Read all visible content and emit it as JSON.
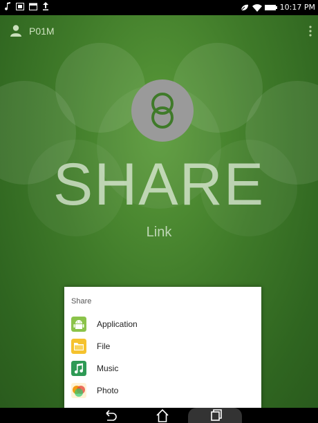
{
  "status_bar": {
    "time": "10:17 PM",
    "left_icons": [
      "music-note-icon",
      "screenshot-icon",
      "calendar-icon",
      "upload-icon"
    ],
    "right_icons": [
      "power-saver-icon",
      "wifi-icon",
      "battery-icon"
    ]
  },
  "header": {
    "device_name": "P01M",
    "avatar_icon": "person-icon",
    "menu_icon": "overflow-menu-icon"
  },
  "main": {
    "logo_icon": "link-rings-icon",
    "title": "SHARE",
    "subtitle": "Link"
  },
  "share_dialog": {
    "title": "Share",
    "items": [
      {
        "label": "Application",
        "icon": "android-icon",
        "color": "#8bc34a"
      },
      {
        "label": "File",
        "icon": "folder-icon",
        "color": "#f5c22e"
      },
      {
        "label": "Music",
        "icon": "music-icon",
        "color": "#2e9a55"
      },
      {
        "label": "Photo",
        "icon": "photo-icon",
        "color": "#f39c12"
      }
    ]
  },
  "nav_bar": {
    "back_icon": "back-icon",
    "home_icon": "home-icon",
    "recents_icon": "recents-icon"
  },
  "colors": {
    "background_green": "#3f7a29",
    "logo_circle": "#9a9a9a",
    "dialog_bg": "#ffffff"
  }
}
